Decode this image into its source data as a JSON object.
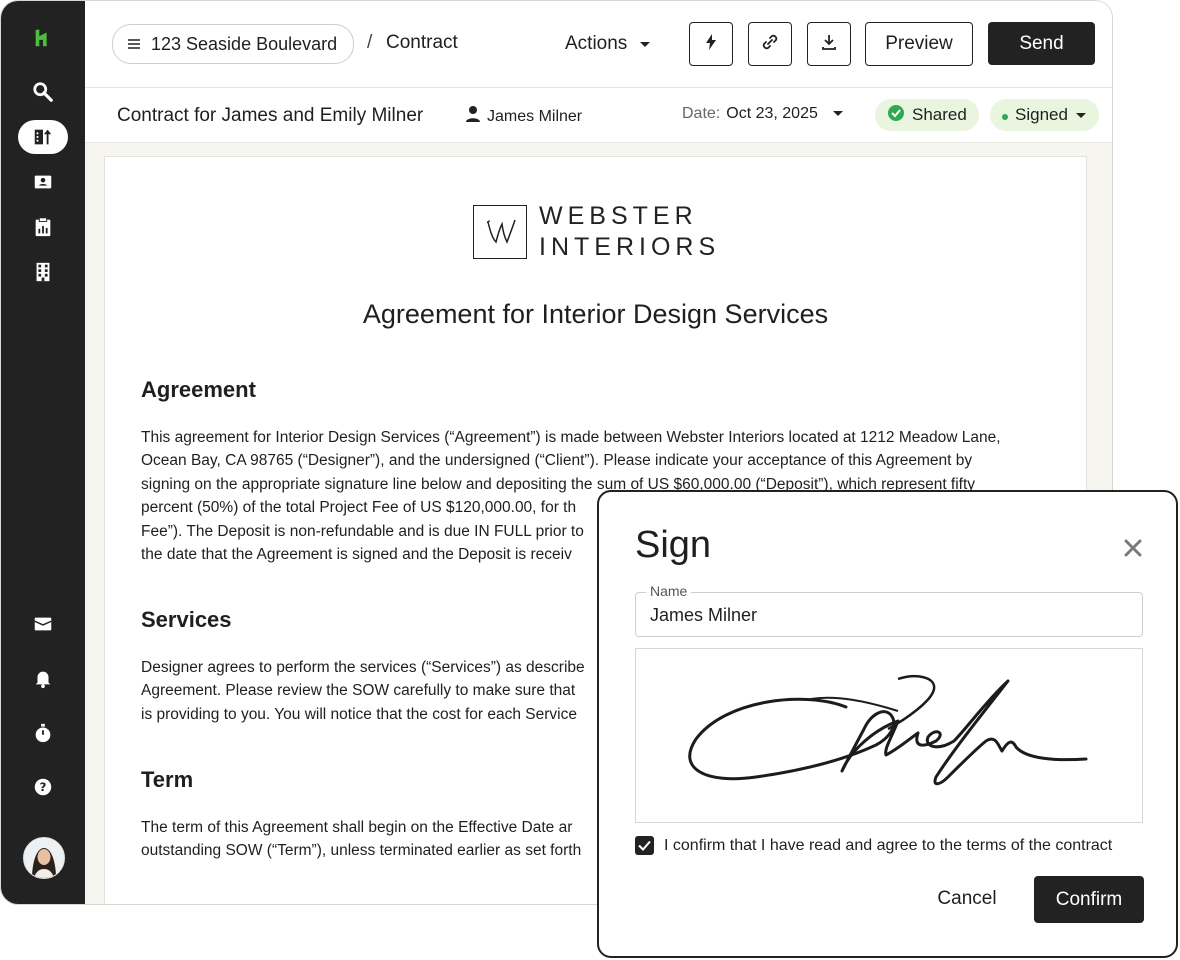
{
  "header": {
    "project": "123 Seaside Boulevard",
    "separator": "/",
    "current": "Contract",
    "actions_label": "Actions",
    "preview_label": "Preview",
    "send_label": "Send",
    "icons": [
      "menu-icon",
      "lightning-icon",
      "link-icon",
      "download-icon",
      "chevron-down-icon"
    ]
  },
  "subheader": {
    "title": "Contract for James and Emily Milner",
    "client": "James Milner",
    "date_label": "Date:",
    "date_value": "Oct 23, 2025",
    "shared_label": "Shared",
    "signed_label": "Signed",
    "shared_color": "#2fa84f"
  },
  "sidebar": {
    "icons": [
      "logo-icon",
      "search-icon",
      "projects-icon",
      "contacts-icon",
      "clipboard-icon",
      "building-icon",
      "inbox-icon",
      "bell-icon",
      "timer-icon",
      "help-icon",
      "avatar"
    ]
  },
  "document": {
    "logo_line1": "WEBSTER",
    "logo_line2": "INTERIORS",
    "title": "Agreement for Interior Design Services",
    "sections": [
      {
        "heading": "Agreement",
        "lines": [
          "This agreement for Interior Design Services (“Agreement”) is made between Webster Interiors located at 1212 Meadow Lane,",
          "Ocean Bay, CA 98765 (“Designer”), and the undersigned (“Client”). Please indicate your acceptance of this Agreement by",
          "signing on the appropriate signature line below and depositing the sum of US $60,000.00 (“Deposit”), which represent fifty",
          "percent (50%) of the total Project Fee of US $120,000.00, for th",
          "Fee”). The Deposit is non-refundable and is due IN FULL prior to",
          "the date that the Agreement is signed and the Deposit is receiv"
        ]
      },
      {
        "heading": "Services",
        "lines": [
          "Designer agrees to perform the services (“Services”) as describe",
          "Agreement. Please review the SOW carefully to make sure that",
          "is providing to you. You will notice that the cost for each Service"
        ]
      },
      {
        "heading": "Term",
        "lines": [
          "The term of this Agreement shall begin on the Effective Date ar",
          "outstanding SOW (“Term”), unless terminated earlier as set forth"
        ]
      }
    ]
  },
  "sign_modal": {
    "title": "Sign",
    "close_icon": "close-icon",
    "name_label": "Name",
    "name_value": "James Milner",
    "confirm_text": "I confirm that I have read and agree to the terms of the contract",
    "cancel_label": "Cancel",
    "confirm_label": "Confirm"
  }
}
